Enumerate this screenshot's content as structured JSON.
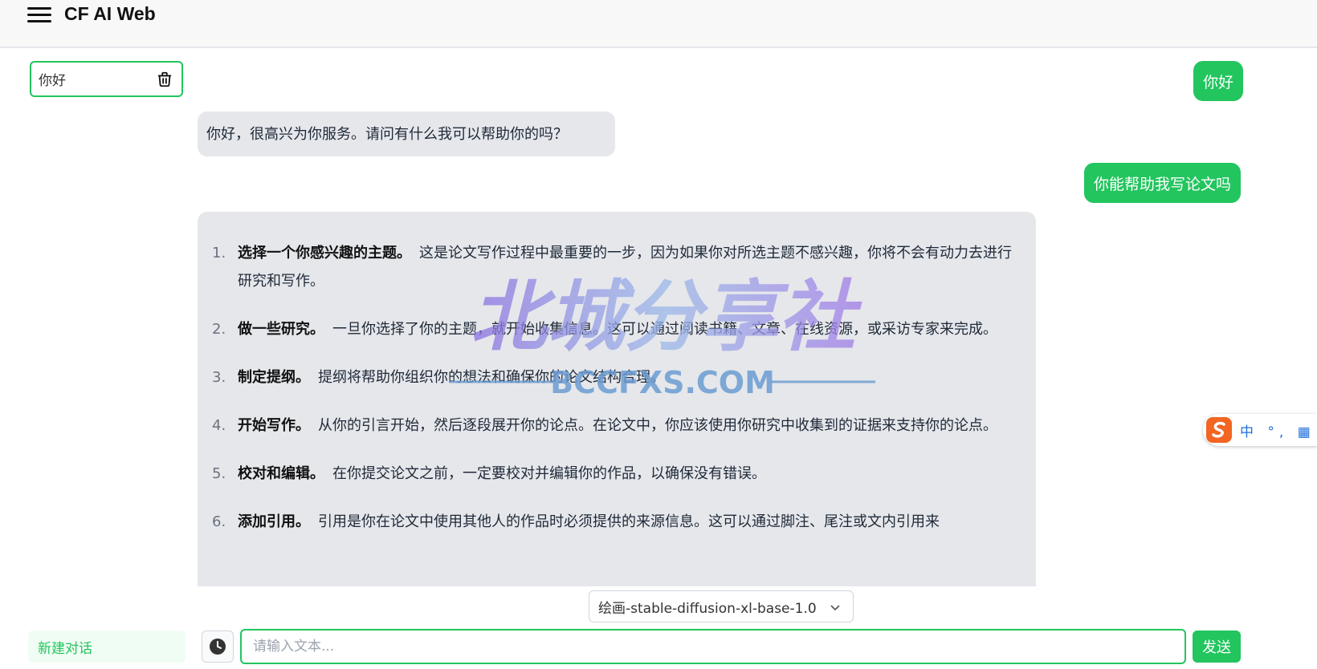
{
  "header": {
    "title": "CF AI Web",
    "menu_icon": "hamburger-menu-icon"
  },
  "sidebar": {
    "conversations": [
      {
        "label": "你好"
      }
    ],
    "new_chat_label": "新建对话"
  },
  "messages": {
    "user_1": "你好",
    "ai_1": "你好，很高兴为你服务。请问有什么我可以帮助你的吗？",
    "user_2": "你能帮助我写论文吗",
    "ai_2": {
      "items": [
        {
          "num": "1.",
          "title": "选择一个你感兴趣的主题。",
          "text": "这是论文写作过程中最重要的一步，因为如果你对所选主题不感兴趣，你将不会有动力去进行研究和写作。"
        },
        {
          "num": "2.",
          "title": "做一些研究。",
          "text": "一旦你选择了你的主题，就开始收集信息。这可以通过阅读书籍、文章、在线资源，或采访专家来完成。"
        },
        {
          "num": "3.",
          "title": "制定提纲。",
          "text": "提纲将帮助你组织你的想法和确保你的论文结构合理。"
        },
        {
          "num": "4.",
          "title": "开始写作。",
          "text": "从你的引言开始，然后逐段展开你的论点。在论文中，你应该使用你研究中收集到的证据来支持你的论点。"
        },
        {
          "num": "5.",
          "title": "校对和编辑。",
          "text": "在你提交论文之前，一定要校对并编辑你的作品，以确保没有错误。"
        },
        {
          "num": "6.",
          "title": "添加引用。",
          "text": "引用是你在论文中使用其他人的作品时必须提供的来源信息。这可以通过脚注、尾注或文内引用来"
        }
      ]
    }
  },
  "watermark": {
    "title": "北城分享社",
    "subtitle": "BCCFXS.COM"
  },
  "ime": {
    "text": "中 °, ▦"
  },
  "composer": {
    "model": "绘画-stable-diffusion-xl-base-1.0",
    "placeholder": "请输入文本...",
    "send_label": "发送"
  },
  "colors": {
    "accent": "#22c55e",
    "ai_bubble": "#e5e7eb"
  }
}
